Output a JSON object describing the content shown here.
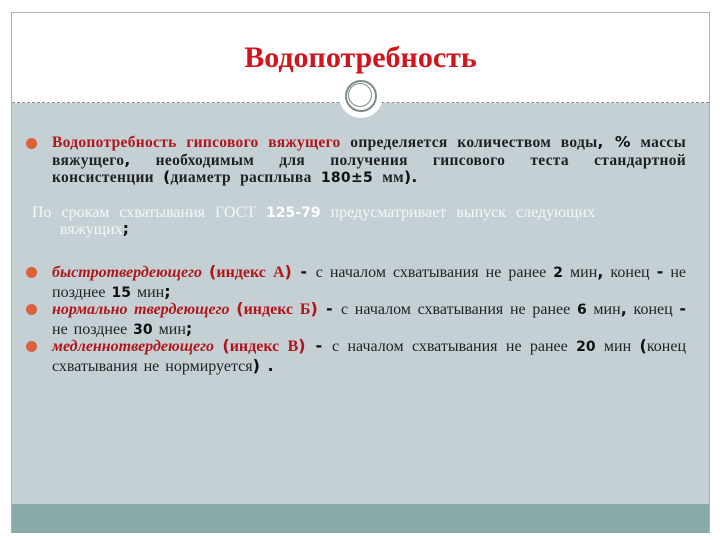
{
  "slide": {
    "title": "Водопотребность",
    "colors": {
      "title": "#d2141c",
      "accent_red": "#b0151a",
      "bullet": "#d9613c",
      "content_bg": "#c5d0d5",
      "footer_strip": "#8aaaa9"
    },
    "paragraph1": {
      "red_lead": "Водопотребность гипсового вяжущего",
      "text1": " определяется количеством воды",
      "comma": ",",
      "percent": " %",
      "text2": " массы вяжущего",
      "comma2": ",",
      "text3": " необходимым для получения гипсового теста стандартной консистенции ",
      "open_paren": "(",
      "text4": "диаметр расплыва ",
      "value": "180±5",
      "text5": " мм",
      "close": ")."
    },
    "gost_paragraph": {
      "text1": "По срокам схватывания ГОСТ ",
      "gost_number": "125-79",
      "text2": " предусматривает выпуск следующих",
      "text3": "вяжущих",
      "semicolon": ";"
    },
    "list": [
      {
        "name": "быстротвердеющего",
        "open": "(",
        "index": "индекс А",
        "close": ")",
        "dash": " - ",
        "text1": "с началом схватывания не ранее ",
        "start_min": "2",
        "text2": " мин",
        "comma": ",",
        "text3": " конец ",
        "dash2": "-",
        "text4": " не позднее ",
        "end_min": "15",
        "text5": " мин",
        "end": ";"
      },
      {
        "name": " нормально твердеющего",
        "open": "(",
        "index": "индекс Б",
        "close": ")",
        "dash": " - ",
        "text1": "с началом схватывания не ранее ",
        "start_min": "6",
        "text2": " мин",
        "comma": ",",
        "text3": " конец ",
        "dash2": "-",
        "text4": " не позднее ",
        "end_min": "30",
        "text5": " мин",
        "end": ";"
      },
      {
        "name": "медленнотвердеющего",
        "open": "(",
        "index": "индекс В",
        "close": ")",
        "dash": " - ",
        "text1": "с началом схватывания не ранее ",
        "start_min": "20",
        "text2": " мин ",
        "open2": "(",
        "text3": "конец схватывания не нормируется",
        "end": ") ."
      }
    ]
  }
}
